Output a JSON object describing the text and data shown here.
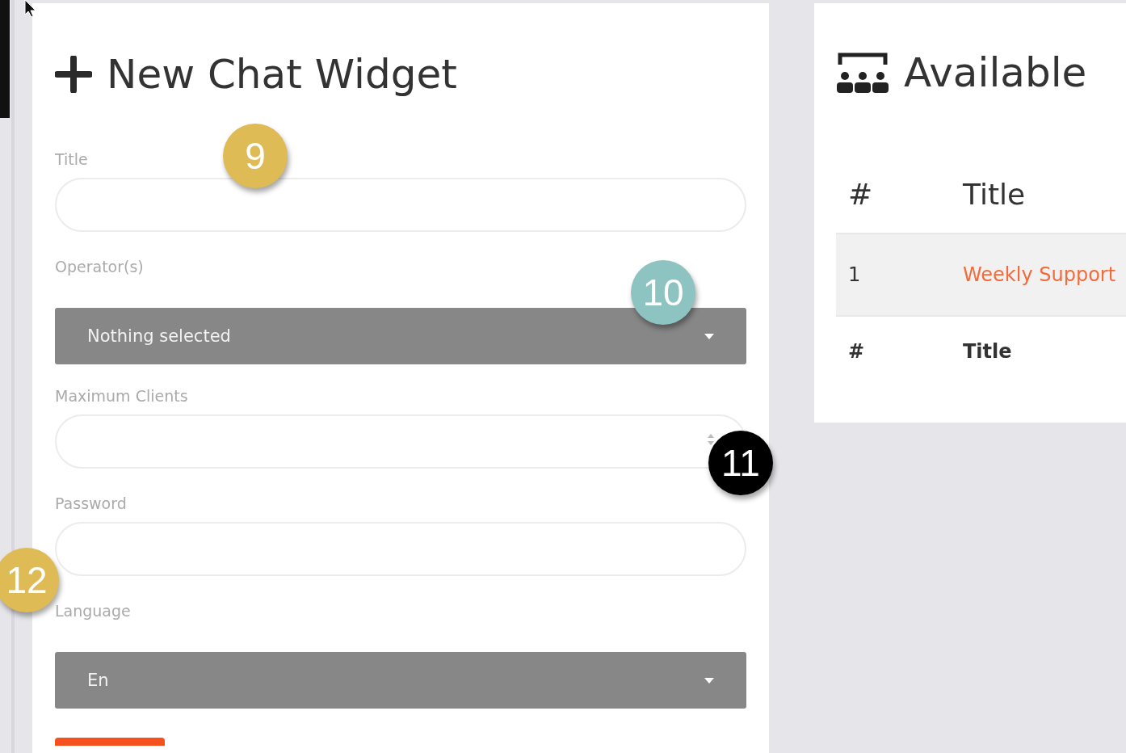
{
  "form_panel": {
    "title": "New Chat Widget",
    "fields": [
      {
        "kind": "text",
        "label": "Title"
      },
      {
        "kind": "select",
        "label": "Operator(s)",
        "value": "Nothing selected"
      },
      {
        "kind": "number",
        "label": "Maximum Clients"
      },
      {
        "kind": "password",
        "label": "Password"
      },
      {
        "kind": "select",
        "label": "Language",
        "value": "En"
      }
    ]
  },
  "groups_panel": {
    "title": "Available",
    "table": {
      "columns": [
        "#",
        "Title"
      ],
      "rows": [
        [
          "1",
          "Weekly Support"
        ]
      ],
      "footer": [
        "#",
        "Title"
      ]
    }
  },
  "annotations": [
    {
      "label": "9",
      "color": "#dfbb55"
    },
    {
      "label": "10",
      "color": "#8dc3c0"
    },
    {
      "label": "11",
      "color": "#000000"
    },
    {
      "label": "12",
      "color": "#dfbb55"
    }
  ]
}
